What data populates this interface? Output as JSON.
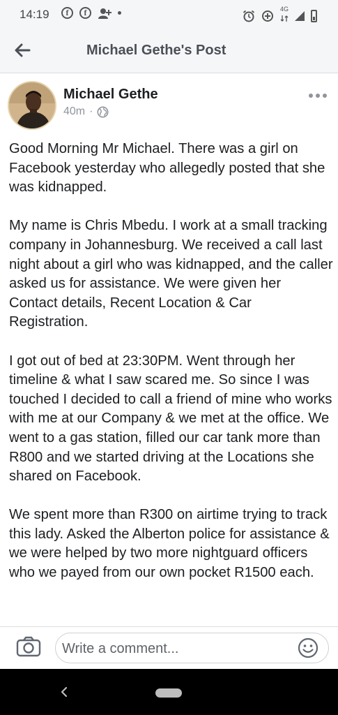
{
  "status_bar": {
    "time": "14:19",
    "network": "4G"
  },
  "header": {
    "title": "Michael Gethe's Post"
  },
  "post": {
    "author": "Michael Gethe",
    "time": "40m",
    "separator": "·",
    "paragraphs": [
      "Good Morning Mr Michael. There was a girl on Facebook yesterday who allegedly posted that she was kidnapped.",
      "My name is Chris Mbedu. I work at a small tracking company in Johannesburg. We received a call last night about a girl who was kidnapped, and the caller asked us for assistance. We were given her Contact details, Recent Location & Car Registration.",
      "I got out of bed at 23:30PM. Went through her timeline & what I saw scared me. So since I was touched I decided to call a friend of mine who works with me at our Company & we met at the office. We went to a gas station, filled our car tank more than R800 and we started driving at the Locations she shared on Facebook.",
      "We spent more than R300 on airtime trying to track this lady. Asked the Alberton police for assistance & we were helped by two more nightguard officers who we payed from our own pocket R1500 each."
    ]
  },
  "comment_bar": {
    "placeholder": "Write a comment..."
  }
}
